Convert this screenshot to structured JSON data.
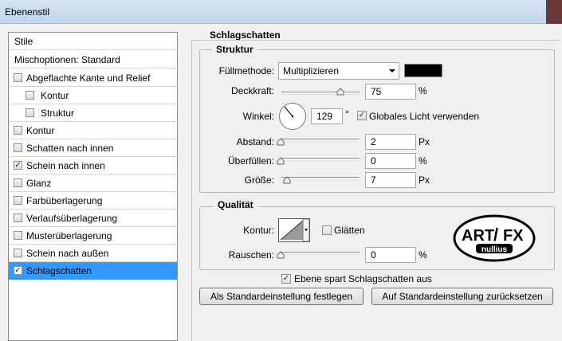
{
  "window": {
    "title": "Ebenenstil"
  },
  "sidebar": {
    "header": "Stile",
    "blend_options": "Mischoptionen: Standard",
    "items": [
      {
        "label": "Abgeflachte Kante und Relief",
        "checked": false,
        "indent": false
      },
      {
        "label": "Kontur",
        "checked": false,
        "indent": true
      },
      {
        "label": "Struktur",
        "checked": false,
        "indent": true
      },
      {
        "label": "Kontur",
        "checked": false,
        "indent": false
      },
      {
        "label": "Schatten nach innen",
        "checked": false,
        "indent": false
      },
      {
        "label": "Schein nach innen",
        "checked": true,
        "indent": false
      },
      {
        "label": "Glanz",
        "checked": false,
        "indent": false
      },
      {
        "label": "Farbüberlagerung",
        "checked": false,
        "indent": false
      },
      {
        "label": "Verlaufsüberlagerung",
        "checked": false,
        "indent": false
      },
      {
        "label": "Musterüberlagerung",
        "checked": false,
        "indent": false
      },
      {
        "label": "Schein nach außen",
        "checked": false,
        "indent": false
      },
      {
        "label": "Schlagschatten",
        "checked": true,
        "indent": false,
        "selected": true
      }
    ]
  },
  "main": {
    "section_title": "Schlagschatten",
    "structure": {
      "title": "Struktur",
      "blend_mode_label": "Füllmethode:",
      "blend_mode_value": "Multiplizieren",
      "shadow_color": "#000000",
      "opacity_label": "Deckkraft:",
      "opacity_value": "75",
      "opacity_unit": "%",
      "opacity_fraction": 0.75,
      "angle_label": "Winkel:",
      "angle_value": "129",
      "angle_unit": "°",
      "global_light_label": "Globales Licht verwenden",
      "global_light_checked": true,
      "distance_label": "Abstand:",
      "distance_value": "2",
      "distance_unit": "Px",
      "spread_label": "Überfüllen:",
      "spread_value": "0",
      "spread_unit": "%",
      "size_label": "Größe:",
      "size_value": "7",
      "size_unit": "Px"
    },
    "quality": {
      "title": "Qualität",
      "contour_label": "Kontur:",
      "antialias_label": "Glätten",
      "antialias_checked": false,
      "noise_label": "Rauschen:",
      "noise_value": "0",
      "noise_unit": "%"
    },
    "knockout_label": "Ebene spart Schlagschatten aus",
    "knockout_checked": true,
    "make_default_label": "Als Standardeinstellung festlegen",
    "reset_default_label": "Auf Standardeinstellung zurücksetzen"
  },
  "logo": {
    "line1": "ART",
    "slash": "/",
    "line2": "FX",
    "sub": "nullius"
  }
}
